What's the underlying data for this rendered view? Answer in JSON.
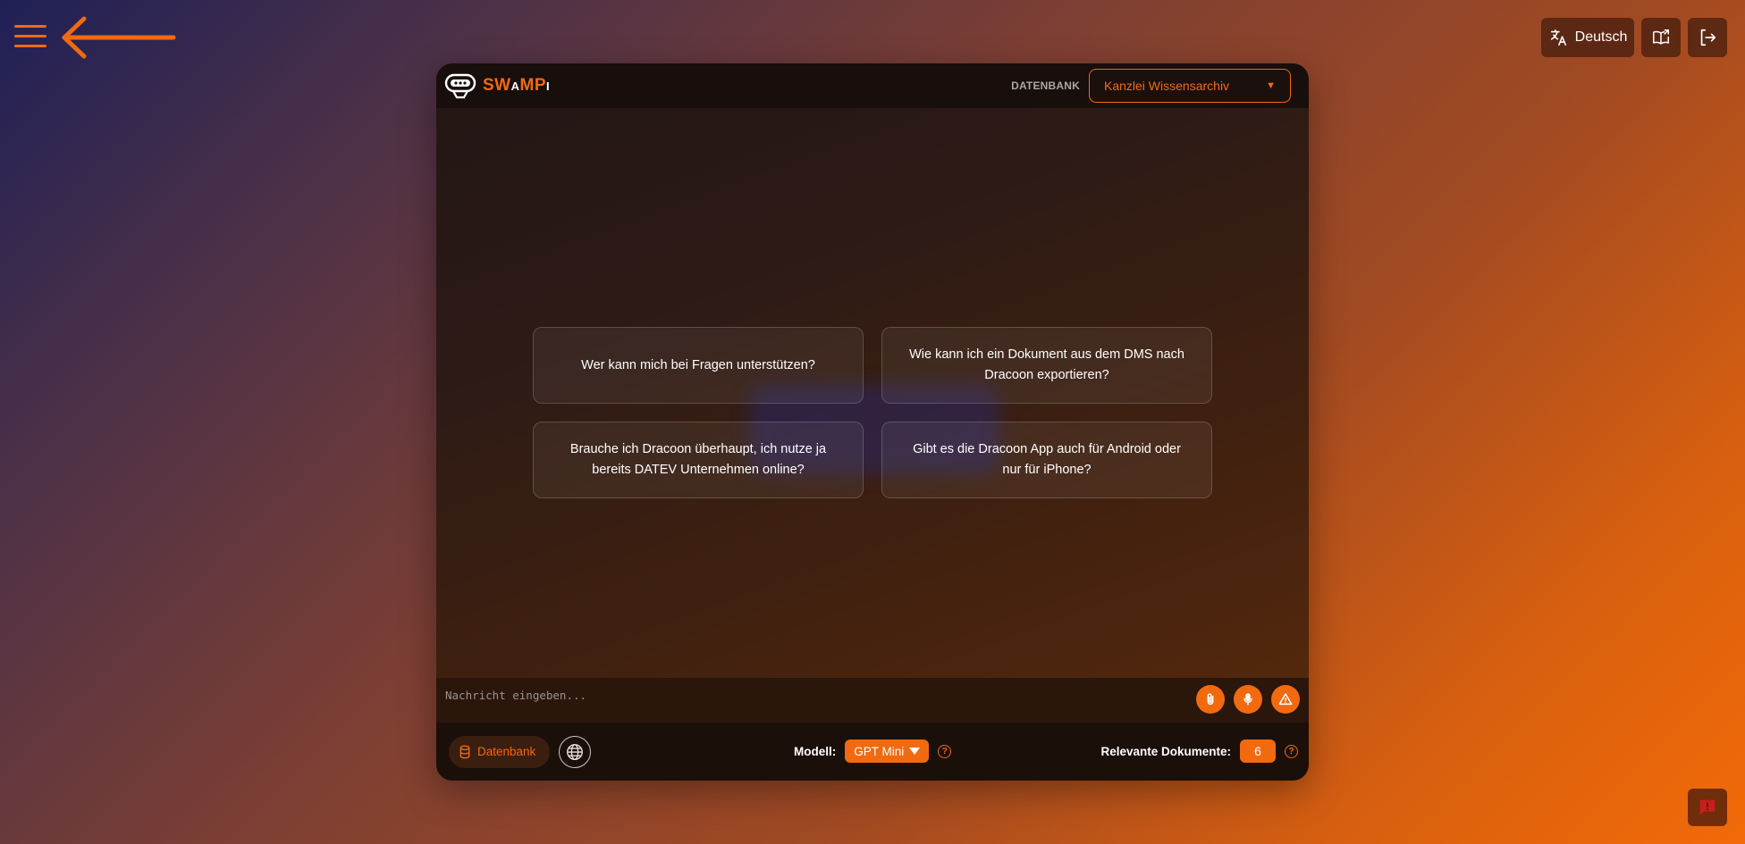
{
  "topbar": {
    "menu_icon": "hamburger-icon",
    "back_icon": "arrow-left-icon",
    "language_label": "Deutsch",
    "language_icon": "translate-icon",
    "docs_icon": "open-book-icon",
    "logout_icon": "logout-icon"
  },
  "header": {
    "logo_text_a": "SW",
    "logo_text_b": "A",
    "logo_text_c": "MP",
    "logo_text_d": "I",
    "database_label": "DATENBANK",
    "database_selected": "Kanzlei Wissensarchiv"
  },
  "suggestions": [
    "Wer kann mich bei Fragen unterstützen?",
    "Wie kann ich ein Dokument aus dem DMS nach Dracoon exportieren?",
    "Brauche ich Dracoon überhaupt, ich nutze ja bereits DATEV Unternehmen online?",
    "Gibt es die Dracoon App auch für Android oder nur für iPhone?"
  ],
  "input": {
    "placeholder": "Nachricht eingeben...",
    "attach_icon": "paperclip-icon",
    "mic_icon": "microphone-icon",
    "warning_icon": "warning-icon"
  },
  "footer": {
    "database_toggle_label": "Datenbank",
    "model_label": "Modell:",
    "model_selected": "GPT Mini",
    "relevant_docs_label": "Relevante Dokumente:",
    "relevant_docs_value": "6",
    "help_glyph": "?"
  },
  "colors": {
    "accent": "#f26a10",
    "header_bg": "#180e0c"
  }
}
